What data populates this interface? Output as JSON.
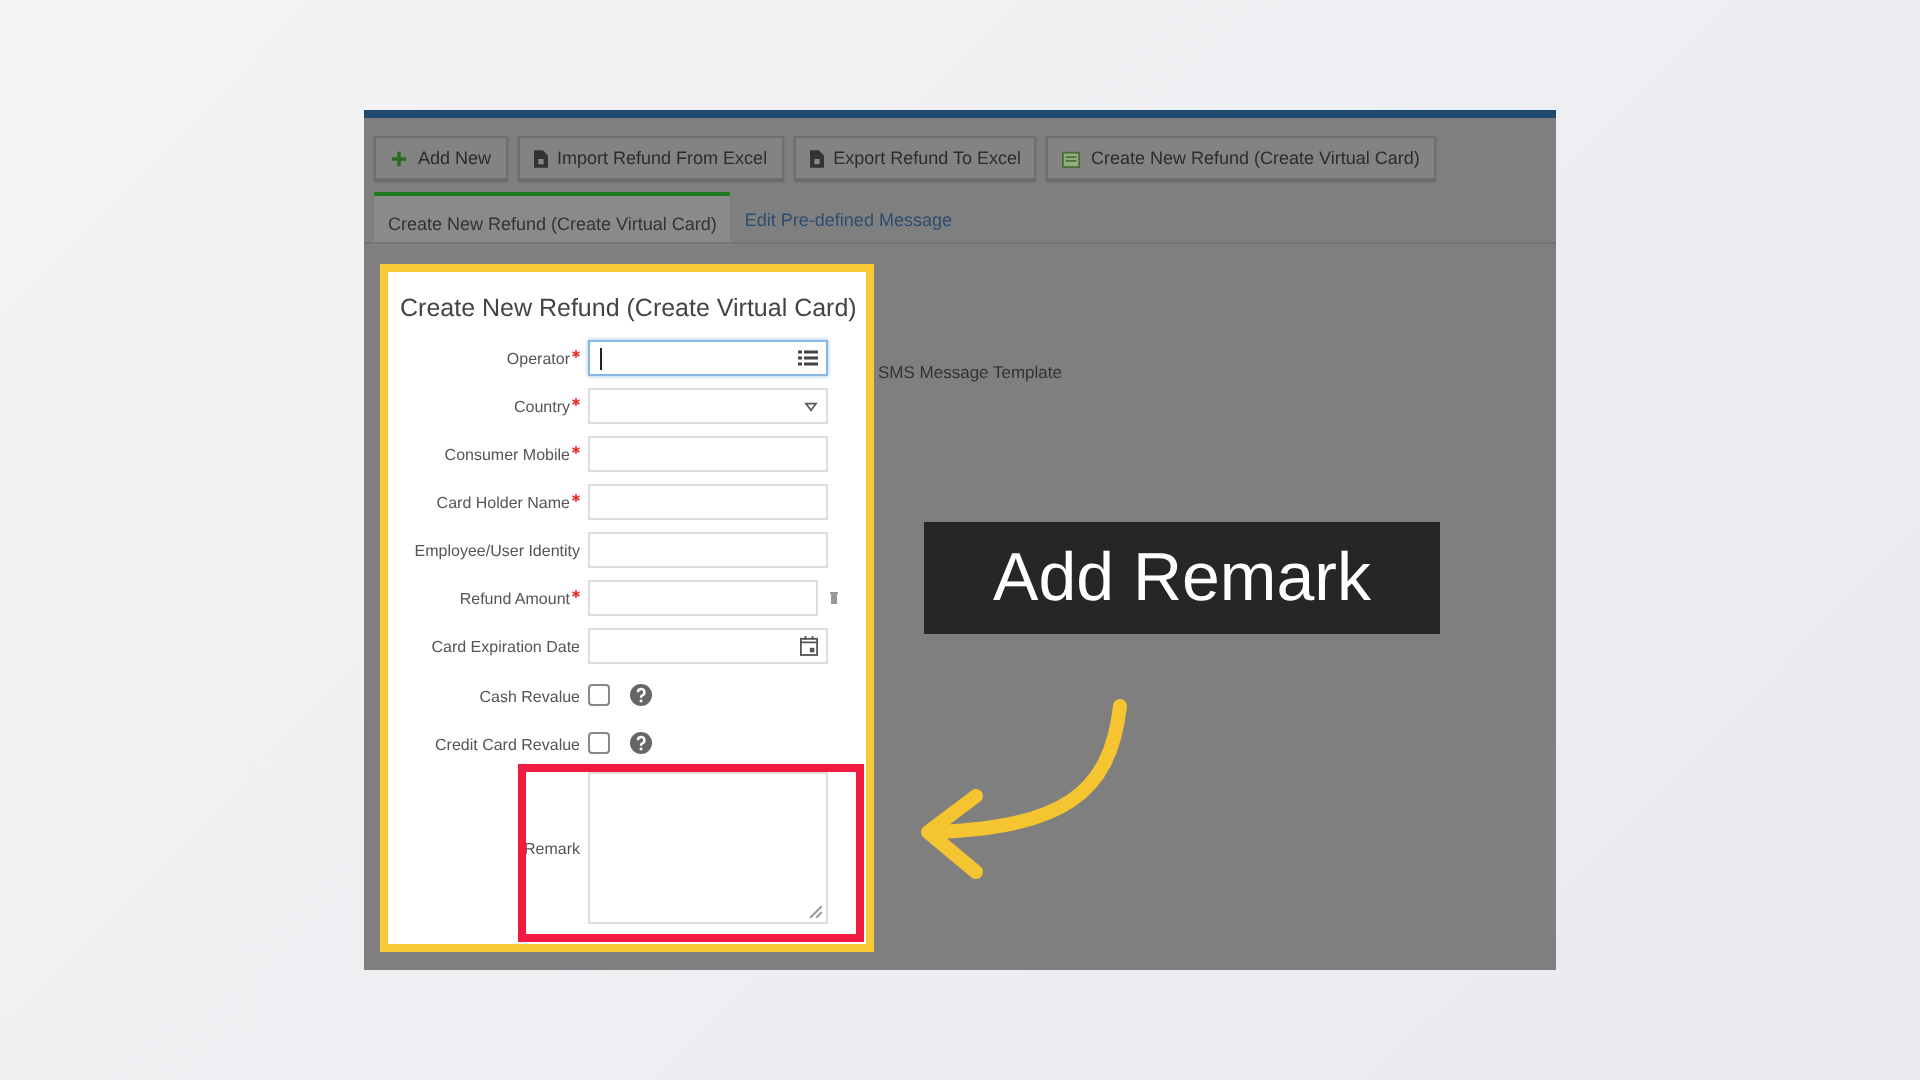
{
  "toolbar": [
    {
      "label": "Add New",
      "kind": "plus"
    },
    {
      "label": "Import Refund From Excel",
      "kind": "document"
    },
    {
      "label": "Export Refund To Excel",
      "kind": "document"
    },
    {
      "label": "Create New Refund (Create Virtual Card)",
      "kind": "card"
    }
  ],
  "tabs": [
    {
      "label": "Create New Refund (Create Virtual Card)",
      "selected": true
    },
    {
      "label": "Edit Pre-defined Message",
      "selected": false
    }
  ],
  "form": {
    "title": "Create New Refund (Create Virtual Card)",
    "fields": [
      {
        "label": "Operator",
        "required": true,
        "kind": "list",
        "focused": true
      },
      {
        "label": "Country",
        "required": true,
        "kind": "select",
        "focused": false
      },
      {
        "label": "Consumer Mobile",
        "required": true,
        "kind": "text",
        "focused": false
      },
      {
        "label": "Card Holder Name",
        "required": true,
        "kind": "text",
        "focused": false
      },
      {
        "label": "Employee/User Identity",
        "required": false,
        "kind": "text",
        "focused": false
      },
      {
        "label": "Refund Amount",
        "required": true,
        "kind": "amount",
        "focused": false
      },
      {
        "label": "Card Expiration Date",
        "required": false,
        "kind": "date",
        "focused": false
      },
      {
        "label": "Cash Revalue",
        "required": false,
        "kind": "checkbox",
        "checked": false
      },
      {
        "label": "Credit Card Revalue",
        "required": false,
        "kind": "checkbox",
        "checked": false
      },
      {
        "label": "Remark",
        "required": false,
        "kind": "textarea",
        "focused": false
      }
    ]
  },
  "sms_label": "SMS Message Template",
  "callout": "Add Remark"
}
